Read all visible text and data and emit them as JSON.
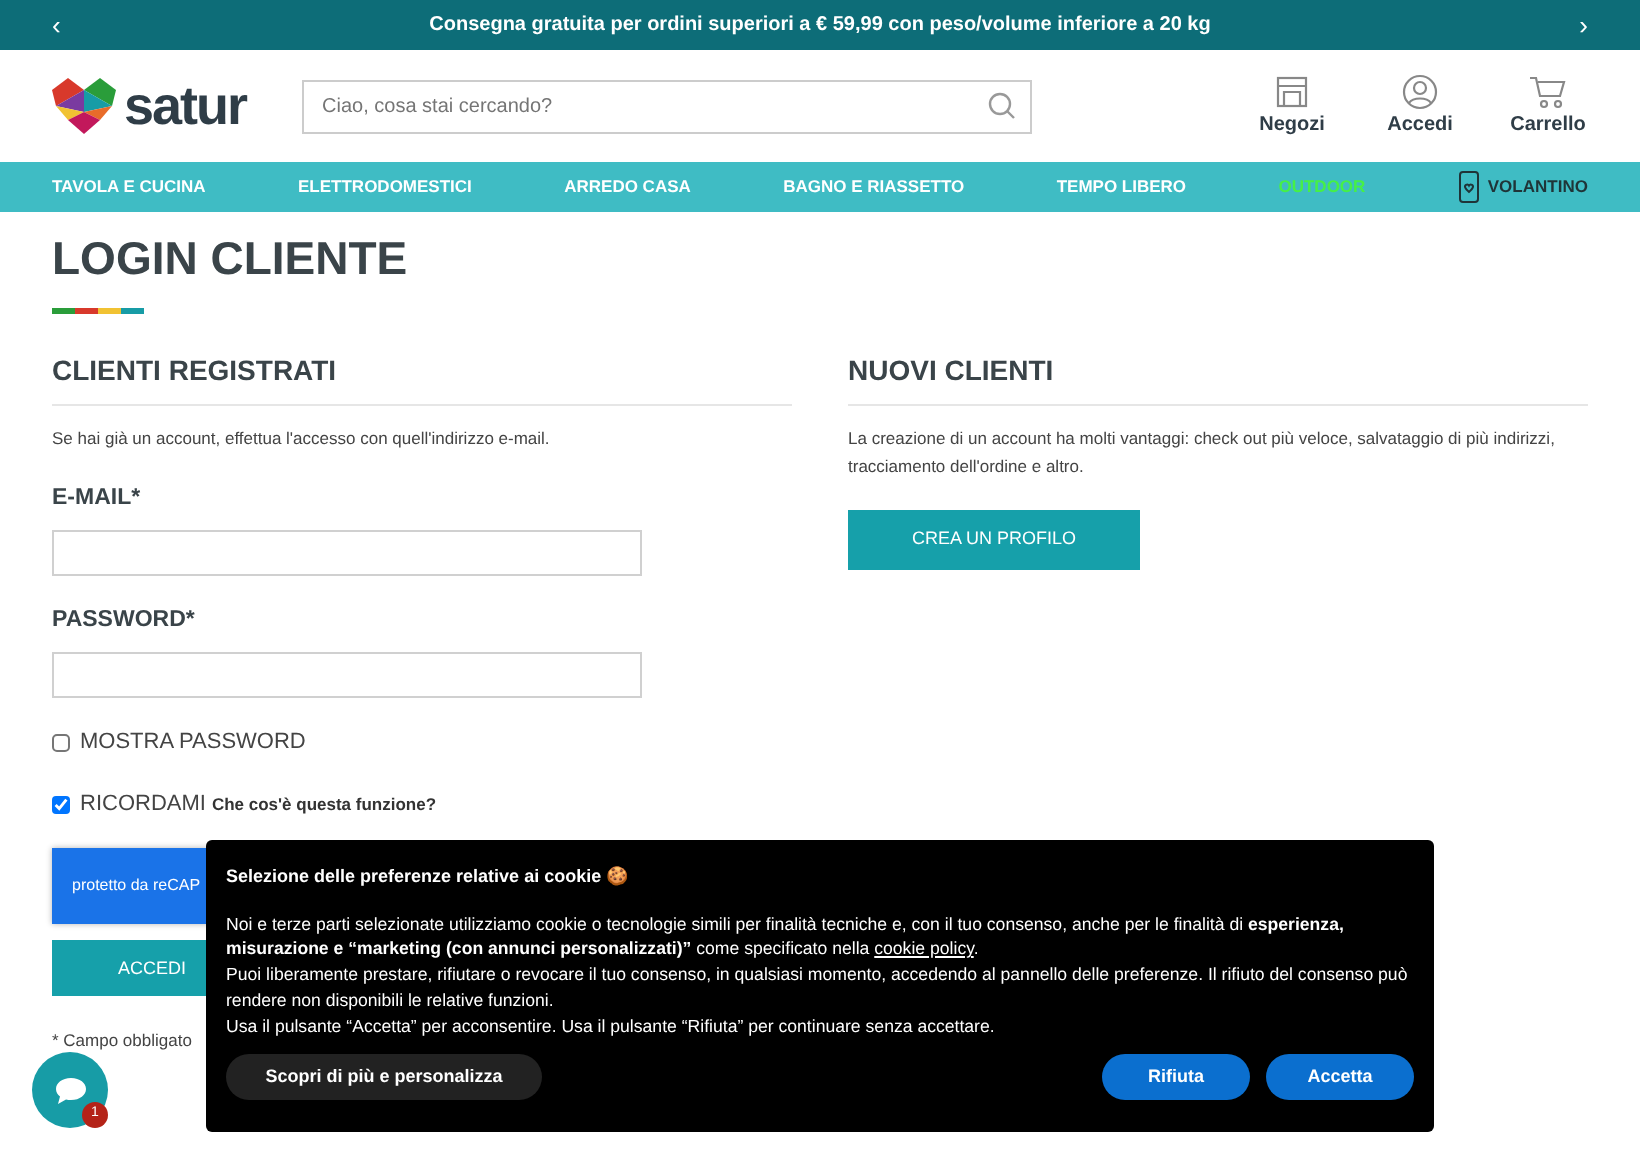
{
  "promo_bar": {
    "prev": "‹",
    "text": "Consegna gratuita per ordini superiori a € 59,99 con peso/volume inferiore a 20 kg",
    "next": "›"
  },
  "header": {
    "logo_text": "satur",
    "search": {
      "placeholder": "Ciao, cosa stai cercando?"
    },
    "actions": [
      {
        "kind": "store",
        "label": "Negozi"
      },
      {
        "kind": "user",
        "label": "Accedi"
      },
      {
        "kind": "cart",
        "label": "Carrello"
      }
    ]
  },
  "nav": [
    {
      "label": "TAVOLA E CUCINA",
      "kind": "link",
      "color": "#ffffff"
    },
    {
      "label": "ELETTRODOMESTICI",
      "kind": "link",
      "color": "#ffffff"
    },
    {
      "label": "ARREDO CASA",
      "kind": "link",
      "color": "#ffffff"
    },
    {
      "label": "BAGNO E RIASSETTO",
      "kind": "link",
      "color": "#ffffff"
    },
    {
      "label": "TEMPO LIBERO",
      "kind": "link",
      "color": "#ffffff"
    },
    {
      "label": "OUTDOOR",
      "kind": "link",
      "color": "#46f046"
    },
    {
      "label": "VOLANTINO",
      "kind": "flyer",
      "color": "#1f3438"
    }
  ],
  "title": "LOGIN CLIENTE",
  "registered": {
    "heading": "CLIENTI REGISTRATI",
    "intro": "Se hai già un account, effettua l'accesso con quell'indirizzo e-mail.",
    "fields": [
      {
        "label": "E-MAIL*"
      },
      {
        "label": "PASSWORD*"
      }
    ],
    "checkboxes": [
      {
        "label": "MOSTRA PASSWORD",
        "checked": false
      },
      {
        "label": "RICORDAMI",
        "checked": true,
        "help": "Che cos'è questa funzione?"
      }
    ],
    "captcha": "protetto da reCAP",
    "submit": "ACCEDI",
    "required_note": "* Campo obbligato"
  },
  "new_customers": {
    "heading": "NUOVI CLIENTI",
    "text": "La creazione di un account ha molti vantaggi: check out più veloce, salvataggio di più indirizzi, tracciamento dell'ordine e altro.",
    "button": "CREA UN PROFILO"
  },
  "chat": {
    "badge": "1"
  },
  "cookie_banner": {
    "title": "Selezione delle preferenze relative ai cookie 🍪",
    "text": "Noi e terze parti selezionate utilizziamo cookie o tecnologie simili per finalità tecniche e, con il tuo consenso, anche per le finalità di **esperienza, misurazione e “marketing (con annunci personalizzati)”** come specificato nella",
    "link": "cookie policy",
    "after_link": ".",
    "text_2": "Puoi liberamente prestare, rifiutare o revocare il tuo consenso, in qualsiasi momento, accedendo al pannello delle preferenze. Il rifiuto del consenso può rendere non disponibili le relative funzioni.",
    "text_3": "Usa il pulsante “Accetta” per acconsentire. Usa il pulsante “Rifiuta” per continuare senza accettare.",
    "buttons": [
      {
        "label": "Scopri di più e personalizza",
        "kind": "secondary"
      },
      {
        "label": "Rifiuta",
        "kind": "primary"
      },
      {
        "label": "Accetta",
        "kind": "primary"
      }
    ]
  }
}
